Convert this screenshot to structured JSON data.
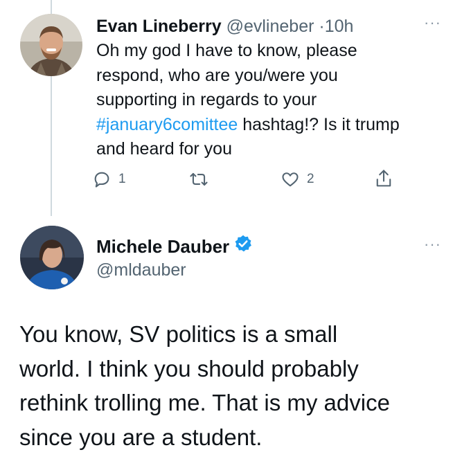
{
  "reply_tweet": {
    "author_name": "Evan Lineberry",
    "author_handle": "@evlineber",
    "separator": "·",
    "time": "10h",
    "text_lines": [
      "Oh my god I have to know, please",
      "respond, who are you/were you",
      "supporting in regards to your"
    ],
    "hashtag": "#january6comittee",
    "text_after_hashtag": " hashtag!? Is it trump",
    "text_last_line": "and heard for you",
    "reply_count": "1",
    "like_count": "2",
    "more_label": "···"
  },
  "main_tweet": {
    "author_name": "Michele Dauber",
    "author_handle": "@mldauber",
    "more_label": "···",
    "text_lines": [
      "You know, SV politics is a small",
      "world. I think you should probably",
      "rethink trolling me. That is my advice",
      "since you are a student."
    ]
  },
  "colors": {
    "link": "#1d9bf0",
    "secondary_text": "#536471",
    "verified": "#1d9bf0",
    "thread_line": "#cfd9de"
  },
  "icons": [
    "reply-icon",
    "retweet-icon",
    "like-icon",
    "share-icon",
    "verified-badge-icon",
    "more-icon"
  ]
}
